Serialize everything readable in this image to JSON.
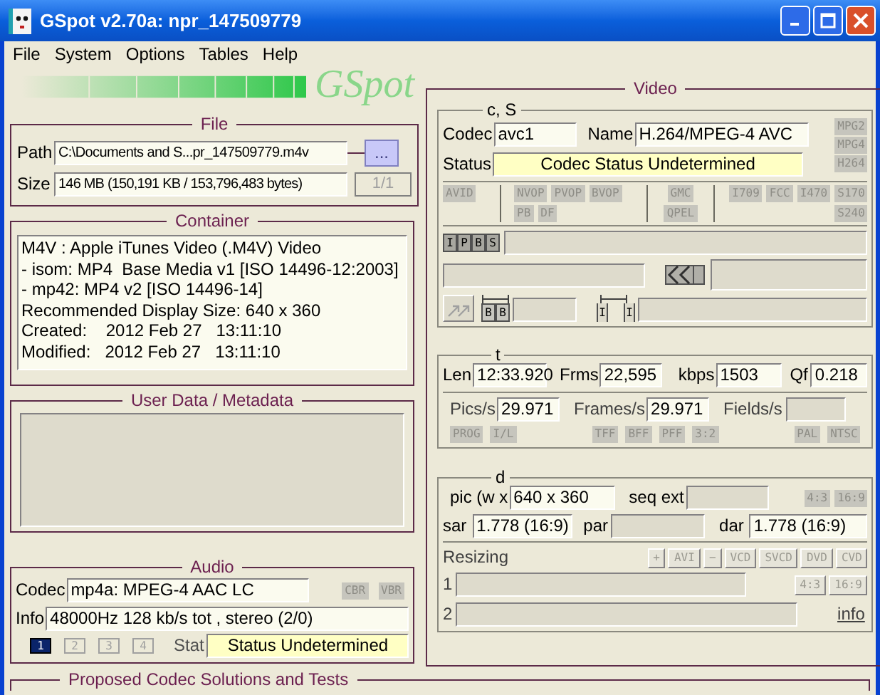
{
  "window": {
    "title": "GSpot v2.70a: npr_147509779"
  },
  "menu": [
    "File",
    "System",
    "Options",
    "Tables",
    "Help"
  ],
  "logo": {
    "text": "GSpot"
  },
  "file": {
    "heading": "File",
    "path_label": "Path",
    "path": "C:\\Documents and S...pr_147509779.m4v",
    "browse": "...",
    "size_label": "Size",
    "size": "146 MB (150,191 KB / 153,796,483 bytes)",
    "page": "1/1"
  },
  "container": {
    "heading": "Container",
    "lines": [
      "M4V : Apple iTunes Video (.M4V) Video",
      "- isom: MP4  Base Media v1 [ISO 14496-12:2003]",
      "- mp42: MP4 v2 [ISO 14496-14]",
      "Recommended Display Size: 640 x 360",
      "Created:    2012 Feb 27   13:11:10",
      "Modified:   2012 Feb 27   13:11:10"
    ]
  },
  "user_data": {
    "heading": "User Data / Metadata"
  },
  "audio": {
    "heading": "Audio",
    "codec_label": "Codec",
    "codec": "mp4a: MPEG-4 AAC LC",
    "flags": [
      "CBR",
      "VBR"
    ],
    "info_label": "Info",
    "info": "48000Hz  128 kb/s tot , stereo (2/0)",
    "streams": [
      {
        "label": "1",
        "selected": true
      },
      {
        "label": "2",
        "selected": false
      },
      {
        "label": "3",
        "selected": false
      },
      {
        "label": "4",
        "selected": false
      }
    ],
    "stat_label": "Stat",
    "stat": "Status Undetermined"
  },
  "proposed": {
    "heading": "Proposed Codec Solutions and Tests"
  },
  "video": {
    "heading": "Video",
    "codec_section": {
      "heading": "c, S",
      "codec_label": "Codec",
      "codec": "avc1",
      "name_label": "Name",
      "name": "H.264/MPEG-4 AVC",
      "status_label": "Status",
      "status": "Codec Status Undetermined",
      "type_flags": [
        "MPG2",
        "MPG4",
        "H264"
      ],
      "flag_groups": [
        [
          "AVID"
        ],
        [
          "NVOP",
          "PVOP",
          "BVOP",
          "PB",
          "DF"
        ],
        [
          "GMC",
          "QPEL"
        ],
        [
          "I709",
          "FCC",
          "I470",
          "S170",
          "S240"
        ]
      ],
      "frame_types": [
        "I",
        "P",
        "B",
        "S"
      ],
      "b_frames": [
        "B",
        "B"
      ],
      "i_frames": [
        "I",
        "I"
      ]
    },
    "timing": {
      "heading": "t",
      "fields": [
        {
          "label": "Len",
          "value": "12:33.920"
        },
        {
          "label": "Frms",
          "value": "22,595"
        },
        {
          "label": "kbps",
          "value": "1503"
        },
        {
          "label": "Qf",
          "value": "0.218"
        }
      ],
      "rates": [
        {
          "label": "Pics/s",
          "value": "29.971"
        },
        {
          "label": "Frames/s",
          "value": "29.971"
        },
        {
          "label": "Fields/s"
        }
      ],
      "flag_groups": [
        [
          "PROG",
          "I/L"
        ],
        [
          "TFF",
          "BFF",
          "PFF",
          "3:2"
        ],
        [
          "PAL",
          "NTSC"
        ]
      ]
    },
    "dimensions": {
      "heading": "d",
      "pic_label": "pic (w x",
      "pic": "640 x 360",
      "seq_ext_label": "seq ext",
      "aspect_flags": [
        "4:3",
        "16:9"
      ],
      "sar_label": "sar",
      "sar": "1.778 (16:9)",
      "par_label": "par",
      "dar_label": "dar",
      "dar": "1.778 (16:9)",
      "resizing_label": "Resizing",
      "resize_buttons": [
        "+",
        "AVI",
        "−",
        "VCD",
        "SVCD",
        "DVD",
        "CVD"
      ],
      "rows": [
        {
          "label": "1",
          "buttons": [
            "4:3",
            "16:9"
          ]
        },
        {
          "label": "2",
          "link": "info"
        }
      ]
    }
  }
}
